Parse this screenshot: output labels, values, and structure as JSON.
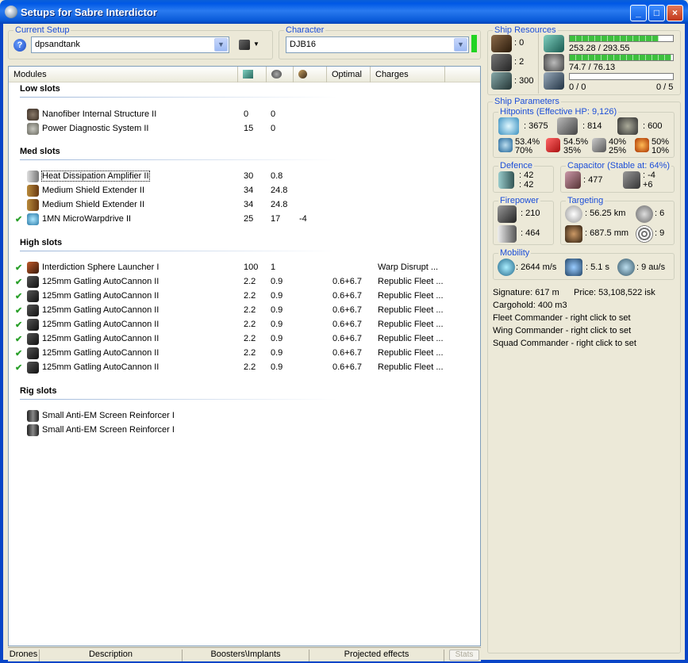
{
  "window": {
    "title": "Setups for Sabre Interdictor"
  },
  "current_setup": {
    "group_title": "Current Setup",
    "value": "dpsandtank"
  },
  "character": {
    "group_title": "Character",
    "value": "DJB16"
  },
  "modules": {
    "headers": [
      "Modules",
      "Optimal",
      "Charges"
    ],
    "low": {
      "title": "Low slots",
      "items": [
        {
          "name": "Nanofiber Internal Structure II",
          "v1": "0",
          "v2": "0",
          "v3": "",
          "optimal": "",
          "charges": "",
          "active": false
        },
        {
          "name": "Power Diagnostic System II",
          "v1": "15",
          "v2": "0",
          "v3": "",
          "optimal": "",
          "charges": "",
          "active": false
        }
      ]
    },
    "med": {
      "title": "Med slots",
      "items": [
        {
          "name": "Heat Dissipation Amplifier II",
          "v1": "30",
          "v2": "0.8",
          "v3": "",
          "optimal": "",
          "charges": "",
          "active": false
        },
        {
          "name": "Medium Shield Extender II",
          "v1": "34",
          "v2": "24.8",
          "v3": "",
          "optimal": "",
          "charges": "",
          "active": false
        },
        {
          "name": "Medium Shield Extender II",
          "v1": "34",
          "v2": "24.8",
          "v3": "",
          "optimal": "",
          "charges": "",
          "active": false
        },
        {
          "name": "1MN MicroWarpdrive II",
          "v1": "25",
          "v2": "17",
          "v3": "-4",
          "optimal": "",
          "charges": "",
          "active": true
        }
      ]
    },
    "high": {
      "title": "High slots",
      "items": [
        {
          "name": "Interdiction Sphere Launcher I",
          "v1": "100",
          "v2": "1",
          "v3": "",
          "optimal": "",
          "charges": "Warp Disrupt ...",
          "active": true
        },
        {
          "name": "125mm Gatling AutoCannon II",
          "v1": "2.2",
          "v2": "0.9",
          "v3": "",
          "optimal": "0.6+6.7",
          "charges": "Republic Fleet ...",
          "active": true
        },
        {
          "name": "125mm Gatling AutoCannon II",
          "v1": "2.2",
          "v2": "0.9",
          "v3": "",
          "optimal": "0.6+6.7",
          "charges": "Republic Fleet ...",
          "active": true
        },
        {
          "name": "125mm Gatling AutoCannon II",
          "v1": "2.2",
          "v2": "0.9",
          "v3": "",
          "optimal": "0.6+6.7",
          "charges": "Republic Fleet ...",
          "active": true
        },
        {
          "name": "125mm Gatling AutoCannon II",
          "v1": "2.2",
          "v2": "0.9",
          "v3": "",
          "optimal": "0.6+6.7",
          "charges": "Republic Fleet ...",
          "active": true
        },
        {
          "name": "125mm Gatling AutoCannon II",
          "v1": "2.2",
          "v2": "0.9",
          "v3": "",
          "optimal": "0.6+6.7",
          "charges": "Republic Fleet ...",
          "active": true
        },
        {
          "name": "125mm Gatling AutoCannon II",
          "v1": "2.2",
          "v2": "0.9",
          "v3": "",
          "optimal": "0.6+6.7",
          "charges": "Republic Fleet ...",
          "active": true
        },
        {
          "name": "125mm Gatling AutoCannon II",
          "v1": "2.2",
          "v2": "0.9",
          "v3": "",
          "optimal": "0.6+6.7",
          "charges": "Republic Fleet ...",
          "active": true
        }
      ]
    },
    "rig": {
      "title": "Rig slots",
      "items": [
        {
          "name": "Small Anti-EM Screen Reinforcer I"
        },
        {
          "name": "Small Anti-EM Screen Reinforcer I"
        }
      ]
    }
  },
  "tabs": [
    "Drones",
    "Description",
    "Boosters\\Implants",
    "Projected effects"
  ],
  "stats_button": "Stats",
  "ship_resources": {
    "title": "Ship Resources",
    "turret_slots": ": 0",
    "launcher_slots": ": 2",
    "calibration": ": 300",
    "cpu_text": "253.28 / 293.55",
    "cpu_fraction": 0.863,
    "power_text": "74.7 / 76.13",
    "power_fraction": 0.981,
    "drone_bay": "0 / 0",
    "drone_bandwidth": "0 / 5",
    "drone_fraction": 0
  },
  "ship_parameters": {
    "title": "Ship Parameters",
    "hitpoints_title": "Hitpoints (Effective HP: 9,126)",
    "shield_hp": ": 3675",
    "armor_hp": ": 814",
    "structure_hp": ": 600",
    "res_1a": "53.4%",
    "res_1b": "70%",
    "res_2a": "54.5%",
    "res_2b": "35%",
    "res_3a": "40%",
    "res_3b": "25%",
    "res_4a": "50%",
    "res_4b": "10%",
    "defence_title": "Defence",
    "defence_1": ": 42",
    "defence_2": ": 42",
    "capacitor_title": "Capacitor (Stable at: 64%)",
    "capacitor_amount": ": 477",
    "capacitor_delta_1": ": -4",
    "capacitor_delta_2": "+6",
    "firepower_title": "Firepower",
    "firepower_1": ": 210",
    "firepower_2": ": 464",
    "targeting_title": "Targeting",
    "targeting_range": ": 56.25 km",
    "targeting_targets": ": 6",
    "targeting_scan": ": 687.5 mm",
    "targeting_sensor": ": 9",
    "mobility_title": "Mobility",
    "velocity": ": 2644 m/s",
    "align": ": 5.1 s",
    "warp": ": 9 au/s",
    "signature": "Signature: 617 m",
    "price": "Price: 53,108,522 isk",
    "cargohold": "Cargohold: 400 m3",
    "fleet": "Fleet Commander - right click to set",
    "wing": "Wing Commander - right click to set",
    "squad": "Squad Commander - right click to set"
  }
}
